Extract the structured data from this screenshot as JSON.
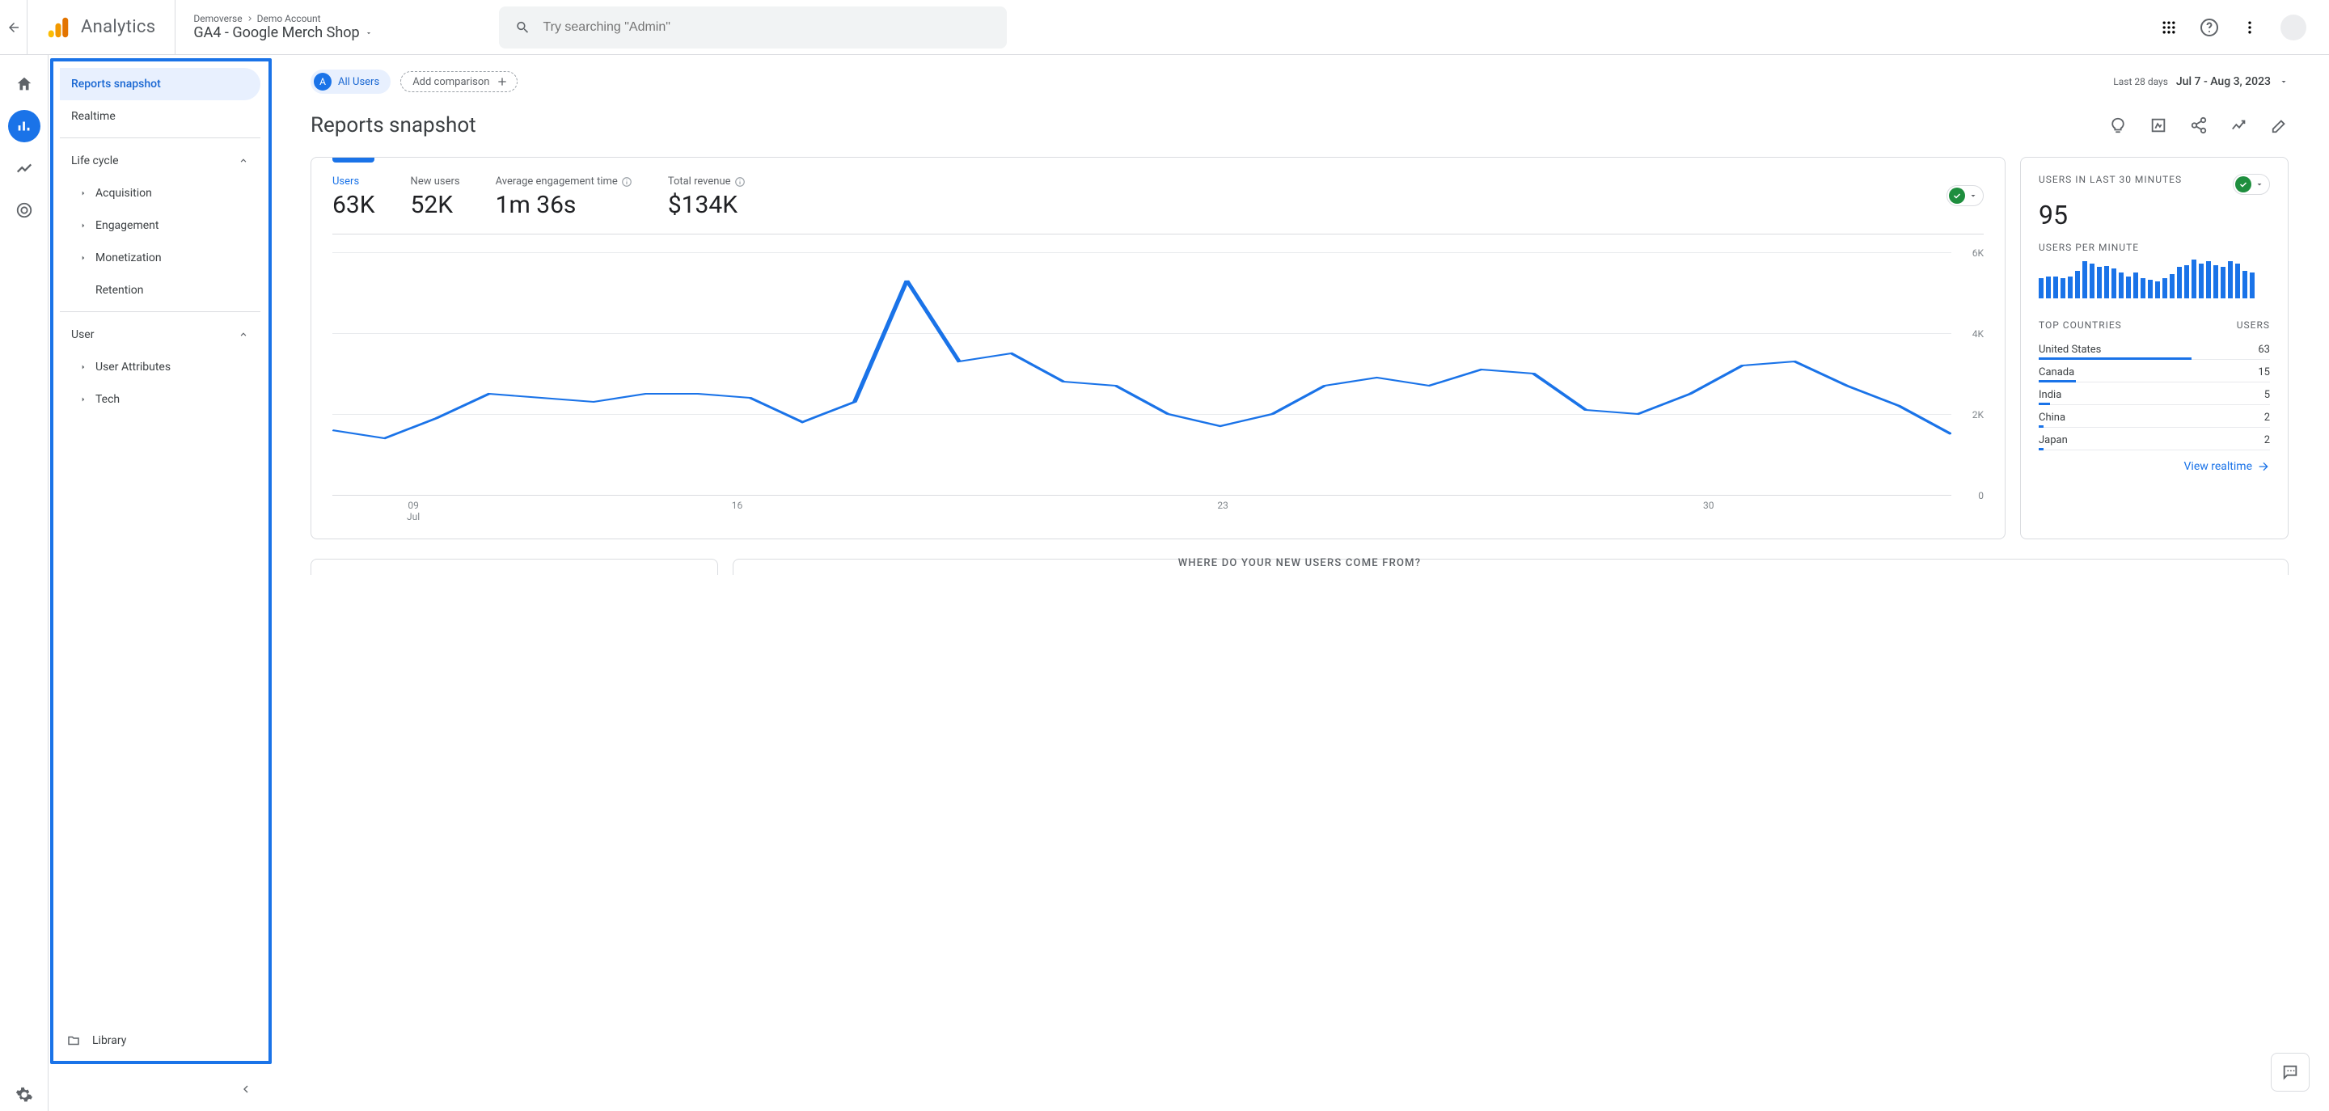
{
  "header": {
    "analytics": "Analytics",
    "breadcrumb": [
      "Demoverse",
      "Demo Account"
    ],
    "property": "GA4 - Google Merch Shop",
    "search_placeholder": "Try searching \"Admin\""
  },
  "sidebar": {
    "items": [
      "Reports snapshot",
      "Realtime"
    ],
    "sections": [
      {
        "label": "Life cycle",
        "children": [
          "Acquisition",
          "Engagement",
          "Monetization",
          "Retention"
        ]
      },
      {
        "label": "User",
        "children": [
          "User Attributes",
          "Tech"
        ]
      }
    ],
    "library": "Library"
  },
  "toolbar": {
    "segment": "All Users",
    "segment_letter": "A",
    "add_comparison": "Add comparison",
    "date_label": "Last 28 days",
    "date_range": "Jul 7 - Aug 3, 2023"
  },
  "page_title": "Reports snapshot",
  "metrics": [
    {
      "label": "Users",
      "value": "63K",
      "active": true
    },
    {
      "label": "New users",
      "value": "52K"
    },
    {
      "label": "Average engagement time",
      "value": "1m 36s",
      "info": true
    },
    {
      "label": "Total revenue",
      "value": "$134K",
      "info": true
    }
  ],
  "chart_data": {
    "type": "line",
    "title": "",
    "xlabel": "",
    "ylabel": "",
    "ylim": [
      0,
      6000
    ],
    "yticks": [
      "0",
      "2K",
      "4K",
      "6K"
    ],
    "xticks": [
      "09\nJul",
      "16",
      "23",
      "30"
    ],
    "x": [
      7,
      8,
      9,
      10,
      11,
      12,
      13,
      14,
      15,
      16,
      17,
      18,
      19,
      20,
      21,
      22,
      23,
      24,
      25,
      26,
      27,
      28,
      29,
      30,
      31,
      32,
      33,
      34
    ],
    "values": [
      1600,
      1400,
      1900,
      2500,
      2400,
      2300,
      2500,
      2500,
      2400,
      1800,
      2300,
      5300,
      3300,
      3500,
      2800,
      2700,
      2000,
      1700,
      2000,
      2700,
      2900,
      2700,
      3100,
      3000,
      2100,
      2000,
      2500,
      3200,
      3300,
      2700,
      2200,
      1500
    ]
  },
  "realtime": {
    "heading": "USERS IN LAST 30 MINUTES",
    "value": "95",
    "per_min": "USERS PER MINUTE",
    "bars": [
      22,
      24,
      24,
      22,
      24,
      30,
      40,
      38,
      34,
      35,
      32,
      28,
      24,
      28,
      22,
      20,
      18,
      22,
      26,
      34,
      36,
      42,
      38,
      40,
      36,
      34,
      40,
      38,
      30,
      28
    ],
    "top_countries_label": "TOP COUNTRIES",
    "users_label": "USERS",
    "countries": [
      {
        "name": "United States",
        "users": "63",
        "pct": 66
      },
      {
        "name": "Canada",
        "users": "15",
        "pct": 16
      },
      {
        "name": "India",
        "users": "5",
        "pct": 5
      },
      {
        "name": "China",
        "users": "2",
        "pct": 2
      },
      {
        "name": "Japan",
        "users": "2",
        "pct": 2
      }
    ],
    "view": "View realtime"
  },
  "section_q": "WHERE DO YOUR NEW USERS COME FROM?"
}
